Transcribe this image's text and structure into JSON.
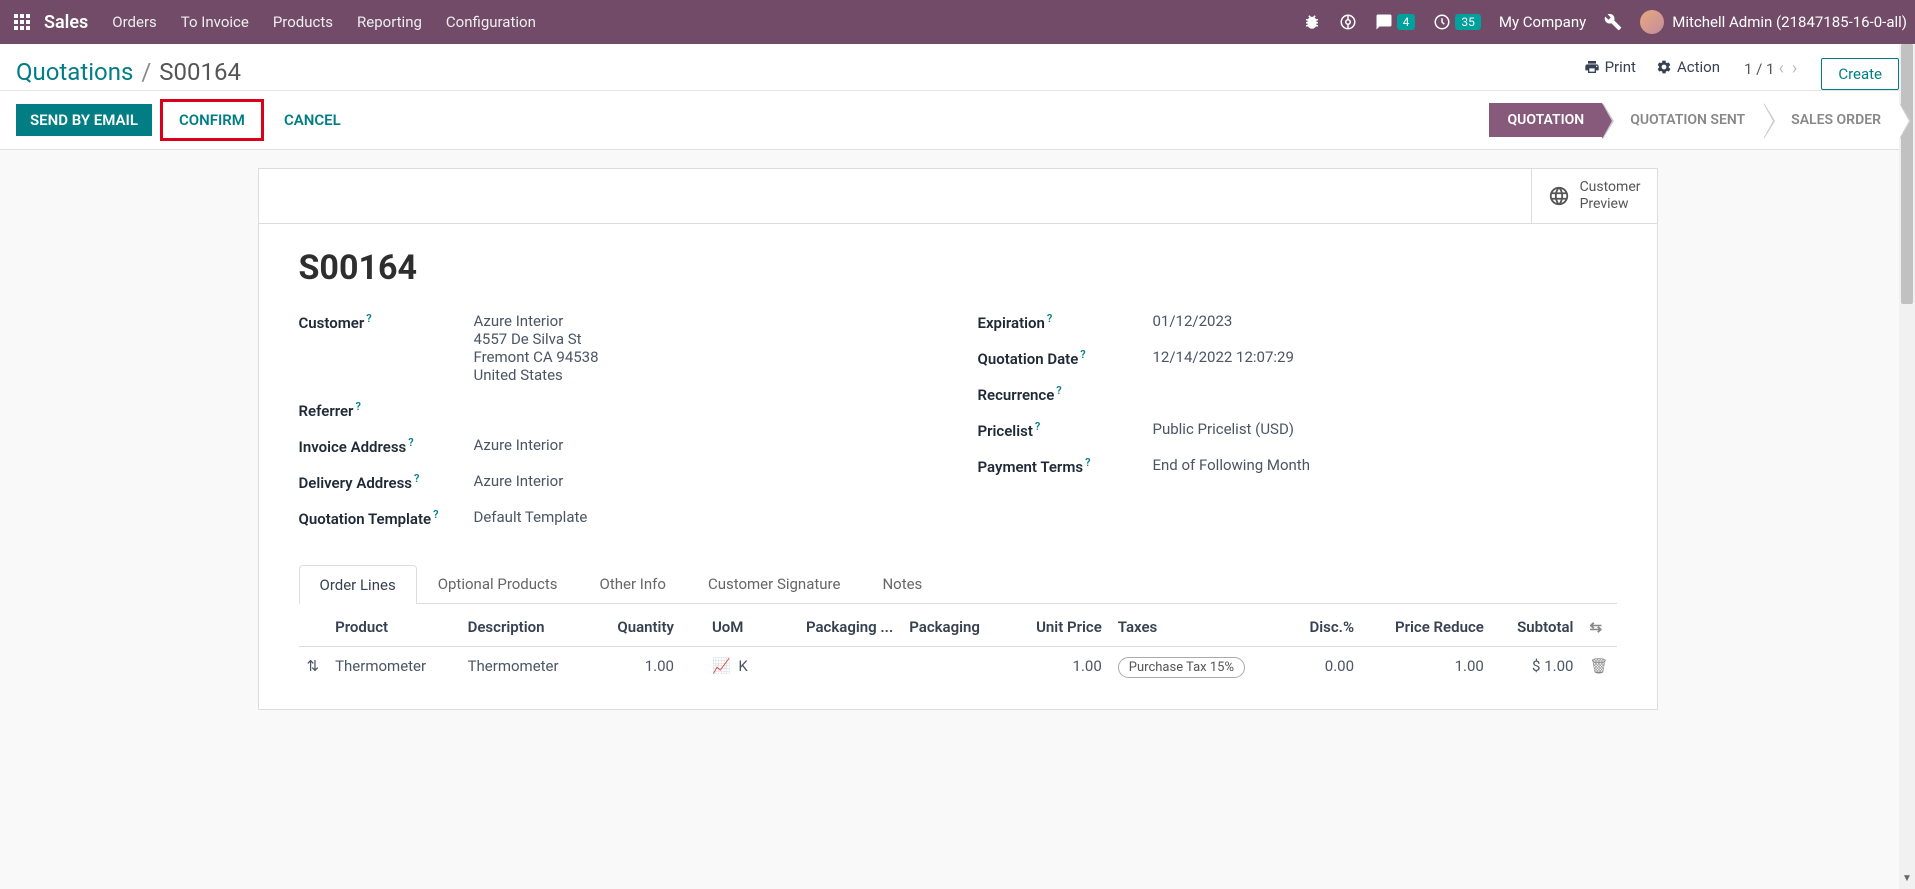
{
  "nav": {
    "brand": "Sales",
    "items": [
      "Orders",
      "To Invoice",
      "Products",
      "Reporting",
      "Configuration"
    ],
    "chat_badge": "4",
    "timer_badge": "35",
    "company": "My Company",
    "user": "Mitchell Admin (21847185-16-0-all)"
  },
  "breadcrumb": {
    "root": "Quotations",
    "current": "S00164"
  },
  "controlbar": {
    "print": "Print",
    "action": "Action",
    "pager": "1 / 1",
    "create": "Create"
  },
  "statusbar": {
    "send": "SEND BY EMAIL",
    "confirm": "CONFIRM",
    "cancel": "CANCEL",
    "stages": [
      "QUOTATION",
      "QUOTATION SENT",
      "SALES ORDER"
    ]
  },
  "preview": {
    "line1": "Customer",
    "line2": "Preview"
  },
  "record": {
    "name": "S00164",
    "left": {
      "customer_label": "Customer",
      "customer_name": "Azure Interior",
      "customer_addr1": "4557 De Silva St",
      "customer_addr2": "Fremont CA 94538",
      "customer_country": "United States",
      "referrer_label": "Referrer",
      "invoice_addr_label": "Invoice Address",
      "invoice_addr": "Azure Interior",
      "delivery_addr_label": "Delivery Address",
      "delivery_addr": "Azure Interior",
      "template_label": "Quotation Template",
      "template": "Default Template"
    },
    "right": {
      "expiration_label": "Expiration",
      "expiration": "01/12/2023",
      "qdate_label": "Quotation Date",
      "qdate": "12/14/2022 12:07:29",
      "recurrence_label": "Recurrence",
      "pricelist_label": "Pricelist",
      "pricelist": "Public Pricelist (USD)",
      "terms_label": "Payment Terms",
      "terms": "End of Following Month"
    }
  },
  "tabs": [
    "Order Lines",
    "Optional Products",
    "Other Info",
    "Customer Signature",
    "Notes"
  ],
  "table": {
    "headers": {
      "product": "Product",
      "description": "Description",
      "quantity": "Quantity",
      "uom": "UoM",
      "packaging_qty": "Packaging ...",
      "packaging": "Packaging",
      "unit_price": "Unit Price",
      "taxes": "Taxes",
      "disc": "Disc.%",
      "price_reduce": "Price Reduce",
      "subtotal": "Subtotal"
    },
    "rows": [
      {
        "product": "Thermometer",
        "description": "Thermometer",
        "quantity": "1.00",
        "uom": "K",
        "unit_price": "1.00",
        "taxes": "Purchase Tax 15%",
        "disc": "0.00",
        "price_reduce": "1.00",
        "subtotal": "$ 1.00"
      }
    ]
  }
}
